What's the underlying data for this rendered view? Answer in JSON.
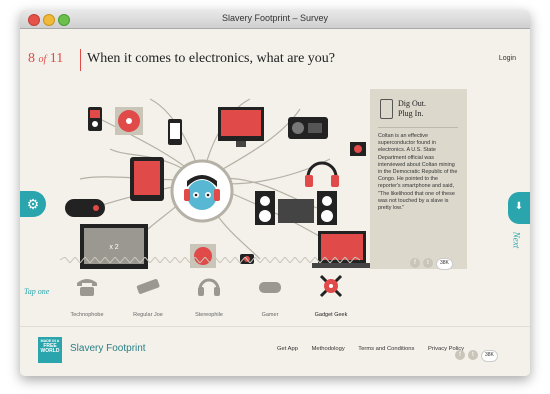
{
  "window": {
    "title": "Slavery Footprint – Survey"
  },
  "header": {
    "current": "8",
    "of": "of",
    "total": "11",
    "question": "When it comes to electronics, what are you?",
    "login": "Login"
  },
  "panel": {
    "title_line1": "Dig Out.",
    "title_line2": "Plug In.",
    "body": "Coltan is an effective superconductor found in electronics. A U.S. State Department official was interviewed about Coltan mining in the Democratic Republic of the Congo. He pointed to the reporter's smartphone and said, \"The likelihood that one of these was not touched by a slave is pretty low.\"",
    "share_count": "38K",
    "share_icons": [
      "facebook-icon",
      "twitter-icon"
    ]
  },
  "tv_label": "x 2",
  "nav": {
    "next": "Next",
    "tap": "Tap one"
  },
  "options": [
    {
      "label": "Technophobe",
      "icon": "telephone-icon",
      "selected": false
    },
    {
      "label": "Regular Joe",
      "icon": "remote-icon",
      "selected": false
    },
    {
      "label": "Stereophile",
      "icon": "headphones-icon",
      "selected": false
    },
    {
      "label": "Gamer",
      "icon": "gamepad-icon",
      "selected": false
    },
    {
      "label": "Gadget Geek",
      "icon": "gadget-icon",
      "selected": true
    }
  ],
  "footer": {
    "logo": [
      "MADE IN A",
      "FREE",
      "WORLD"
    ],
    "brand": "Slavery Footprint",
    "links": [
      "Get App",
      "Methodology",
      "Terms and Conditions",
      "Privacy Policy"
    ],
    "share_count": "38K"
  },
  "colors": {
    "accent": "#e04a48",
    "teal": "#2aa5ad",
    "background": "#f3f1ea",
    "panel": "#dcd8cc"
  }
}
